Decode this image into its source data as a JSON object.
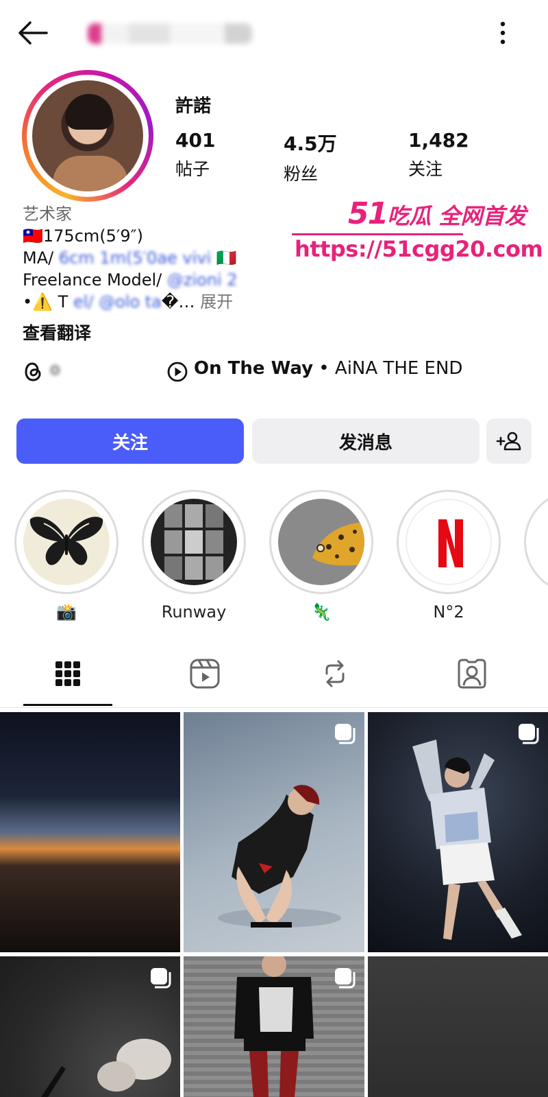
{
  "header": {
    "back_icon": "arrow-left-icon",
    "more_icon": "vertical-dots-icon"
  },
  "profile": {
    "display_name": "許諾",
    "stats": [
      {
        "value": "401",
        "label": "帖子"
      },
      {
        "value": "4.5万",
        "label": "粉丝"
      },
      {
        "value": "1,482",
        "label": "关注"
      }
    ],
    "bio": {
      "category": "艺术家",
      "line1": "🇹🇼175cm(5′9″)",
      "line2_start": "MA/ ",
      "line2_blur": "6cm 1m(5′0ae vivi",
      "line2_end": " 🇮🇹",
      "line3_start": "Freelance Model/ ",
      "line3_blur": "@zioni   2",
      "line4_start": "•⚠️ T",
      "line4_blur": "      el/ @olo   ta",
      "line4_end": "�…",
      "more": "展开"
    },
    "see_translation": "查看翻译"
  },
  "watermark": {
    "brand_num": "51",
    "brand_text": "吃瓜 全网首发",
    "url": "https://51cgg20.com"
  },
  "links": {
    "threads_icon": "threads-icon",
    "threads_handle": "o",
    "music_icon": "play-circle-icon",
    "song": "On The Way",
    "separator": " • ",
    "artist": "AiNA THE END"
  },
  "actions": {
    "follow": "关注",
    "message": "发消息",
    "add_user_icon": "add-user-icon"
  },
  "highlights": [
    {
      "label": "📸",
      "type": "butterfly"
    },
    {
      "label": "Runway",
      "type": "runway"
    },
    {
      "label": "🦎",
      "type": "gecko"
    },
    {
      "label": "N°2",
      "type": "netflix"
    },
    {
      "label": "",
      "type": "partial"
    }
  ],
  "tabs": [
    {
      "name": "grid",
      "icon": "grid-icon",
      "active": true
    },
    {
      "name": "reels",
      "icon": "reels-icon",
      "active": false
    },
    {
      "name": "reposts",
      "icon": "repost-icon",
      "active": false
    },
    {
      "name": "tagged",
      "icon": "tagged-person-icon",
      "active": false
    }
  ],
  "colors": {
    "follow_button": "#4a5df9",
    "secondary_button": "#efeff1",
    "watermark": "#e8227a"
  }
}
